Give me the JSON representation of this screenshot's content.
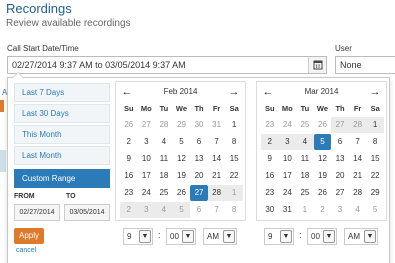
{
  "header": {
    "title": "Recordings",
    "subtitle": "Review available recordings"
  },
  "filters": {
    "call_start_label": "Call Start Date/Time",
    "date_range_value": "02/27/2014 9:37 AM to 03/05/2014 9:37 AM",
    "calendar_icon": "calendar-icon",
    "user_label": "User",
    "user_value": "None"
  },
  "background_peek": {
    "letter": "A"
  },
  "ranges": [
    {
      "label": "Last 7 Days",
      "active": false
    },
    {
      "label": "Last 30 Days",
      "active": false
    },
    {
      "label": "This Month",
      "active": false
    },
    {
      "label": "Last Month",
      "active": false
    },
    {
      "label": "Custom Range",
      "active": true
    }
  ],
  "range_inputs": {
    "from_label": "FROM",
    "from_value": "02/27/2014",
    "to_label": "TO",
    "to_value": "03/05/2014",
    "apply_label": "Apply",
    "cancel_label": "cancel"
  },
  "weekdays": [
    "Su",
    "Mo",
    "Tu",
    "We",
    "Th",
    "Fr",
    "Sa"
  ],
  "calendars": [
    {
      "title": "Feb 2014",
      "prev_glyph": "←",
      "next_glyph": "→",
      "weeks": [
        [
          {
            "d": "26",
            "off": true
          },
          {
            "d": "27",
            "off": true
          },
          {
            "d": "28",
            "off": true
          },
          {
            "d": "29",
            "off": true
          },
          {
            "d": "30",
            "off": true
          },
          {
            "d": "31",
            "off": true
          },
          {
            "d": "1"
          }
        ],
        [
          {
            "d": "2"
          },
          {
            "d": "3"
          },
          {
            "d": "4"
          },
          {
            "d": "5"
          },
          {
            "d": "6"
          },
          {
            "d": "7"
          },
          {
            "d": "8"
          }
        ],
        [
          {
            "d": "9"
          },
          {
            "d": "10"
          },
          {
            "d": "11"
          },
          {
            "d": "12"
          },
          {
            "d": "13"
          },
          {
            "d": "14"
          },
          {
            "d": "15"
          }
        ],
        [
          {
            "d": "16"
          },
          {
            "d": "17"
          },
          {
            "d": "18"
          },
          {
            "d": "19"
          },
          {
            "d": "20"
          },
          {
            "d": "21"
          },
          {
            "d": "22"
          }
        ],
        [
          {
            "d": "23"
          },
          {
            "d": "24"
          },
          {
            "d": "25"
          },
          {
            "d": "26"
          },
          {
            "d": "27",
            "sel": true
          },
          {
            "d": "28",
            "inr": true
          },
          {
            "d": "1",
            "off": true,
            "inr": true
          }
        ],
        [
          {
            "d": "2",
            "off": true,
            "inr": true
          },
          {
            "d": "3",
            "off": true,
            "inr": true
          },
          {
            "d": "4",
            "off": true,
            "inr": true
          },
          {
            "d": "5",
            "off": true,
            "inr": true
          },
          {
            "d": "6",
            "off": true
          },
          {
            "d": "7",
            "off": true
          },
          {
            "d": "8",
            "off": true
          }
        ]
      ],
      "time": {
        "hour": "9",
        "minute": "00",
        "ampm": "AM"
      }
    },
    {
      "title": "Mar 2014",
      "prev_glyph": "←",
      "next_glyph": "→",
      "weeks": [
        [
          {
            "d": "23",
            "off": true
          },
          {
            "d": "24",
            "off": true
          },
          {
            "d": "25",
            "off": true
          },
          {
            "d": "26",
            "off": true
          },
          {
            "d": "27",
            "off": true,
            "inr": true
          },
          {
            "d": "28",
            "off": true,
            "inr": true
          },
          {
            "d": "1",
            "inr": true
          }
        ],
        [
          {
            "d": "2",
            "inr": true
          },
          {
            "d": "3",
            "inr": true
          },
          {
            "d": "4",
            "inr": true
          },
          {
            "d": "5",
            "sel": true
          },
          {
            "d": "6"
          },
          {
            "d": "7"
          },
          {
            "d": "8"
          }
        ],
        [
          {
            "d": "9"
          },
          {
            "d": "10"
          },
          {
            "d": "11"
          },
          {
            "d": "12"
          },
          {
            "d": "13"
          },
          {
            "d": "14"
          },
          {
            "d": "15"
          }
        ],
        [
          {
            "d": "16"
          },
          {
            "d": "17"
          },
          {
            "d": "18"
          },
          {
            "d": "19"
          },
          {
            "d": "20"
          },
          {
            "d": "21"
          },
          {
            "d": "22"
          }
        ],
        [
          {
            "d": "23"
          },
          {
            "d": "24"
          },
          {
            "d": "25"
          },
          {
            "d": "26"
          },
          {
            "d": "27"
          },
          {
            "d": "28"
          },
          {
            "d": "29"
          }
        ],
        [
          {
            "d": "30"
          },
          {
            "d": "31"
          },
          {
            "d": "1",
            "off": true
          },
          {
            "d": "2",
            "off": true
          },
          {
            "d": "3",
            "off": true
          },
          {
            "d": "4",
            "off": true
          },
          {
            "d": "5",
            "off": true
          }
        ]
      ],
      "time": {
        "hour": "9",
        "minute": "00",
        "ampm": "AM"
      }
    }
  ],
  "time_colon": ":",
  "select_arrow": "▼",
  "colors": {
    "accent": "#2b7bb9",
    "apply": "#e07a2b",
    "title": "#1f5f8f",
    "in_range": "#ebebeb"
  }
}
